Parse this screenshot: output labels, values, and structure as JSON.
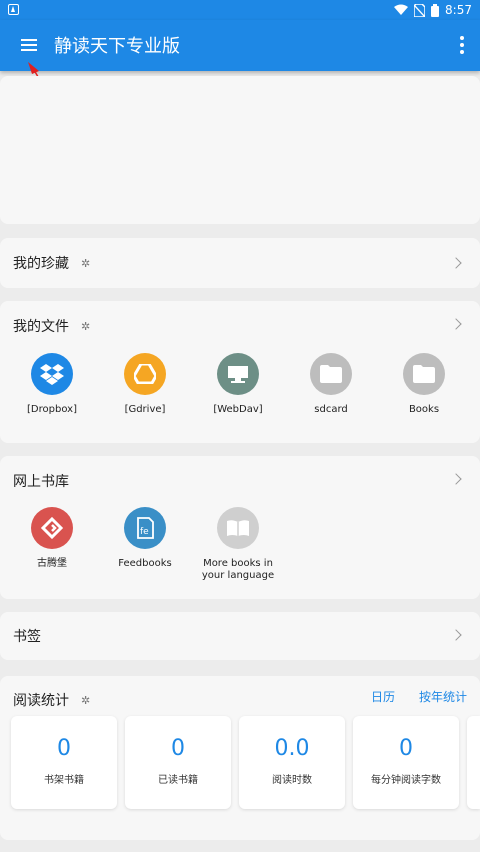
{
  "status_bar": {
    "time": "8:57"
  },
  "app_bar": {
    "title": "静读天下专业版"
  },
  "favorites": {
    "title": "我的珍藏"
  },
  "my_files": {
    "title": "我的文件",
    "items": [
      {
        "label": "[Dropbox]",
        "icon": "dropbox-icon",
        "color": "#1e88e5"
      },
      {
        "label": "[Gdrive]",
        "icon": "gdrive-icon",
        "color": "#f5a623"
      },
      {
        "label": "[WebDav]",
        "icon": "webdav-icon",
        "color": "#6d8f86"
      },
      {
        "label": "sdcard",
        "icon": "folder-icon",
        "color": "#bdbdbd"
      },
      {
        "label": "Books",
        "icon": "folder-icon",
        "color": "#bdbdbd"
      }
    ]
  },
  "online_library": {
    "title": "网上书库",
    "items": [
      {
        "label": "古腾堡",
        "icon": "gutenberg-icon",
        "color": "#d9534f"
      },
      {
        "label": "Feedbooks",
        "icon": "feedbooks-icon",
        "color": "#3a8fc7"
      },
      {
        "label": "More books in your language",
        "icon": "book-icon",
        "color": "#cfcfcf"
      }
    ]
  },
  "bookmarks": {
    "title": "书签"
  },
  "reading_stats": {
    "title": "阅读统计",
    "calendar_link": "日历",
    "yearly_link": "按年统计",
    "cards": [
      {
        "value": "0",
        "label": "书架书籍"
      },
      {
        "value": "0",
        "label": "已读书籍"
      },
      {
        "value": "0.0",
        "label": "阅读时数"
      },
      {
        "value": "0",
        "label": "每分钟阅读字数"
      }
    ]
  },
  "colors": {
    "primary": "#1e88e5",
    "background": "#ececec",
    "card": "#f7f7f7"
  }
}
